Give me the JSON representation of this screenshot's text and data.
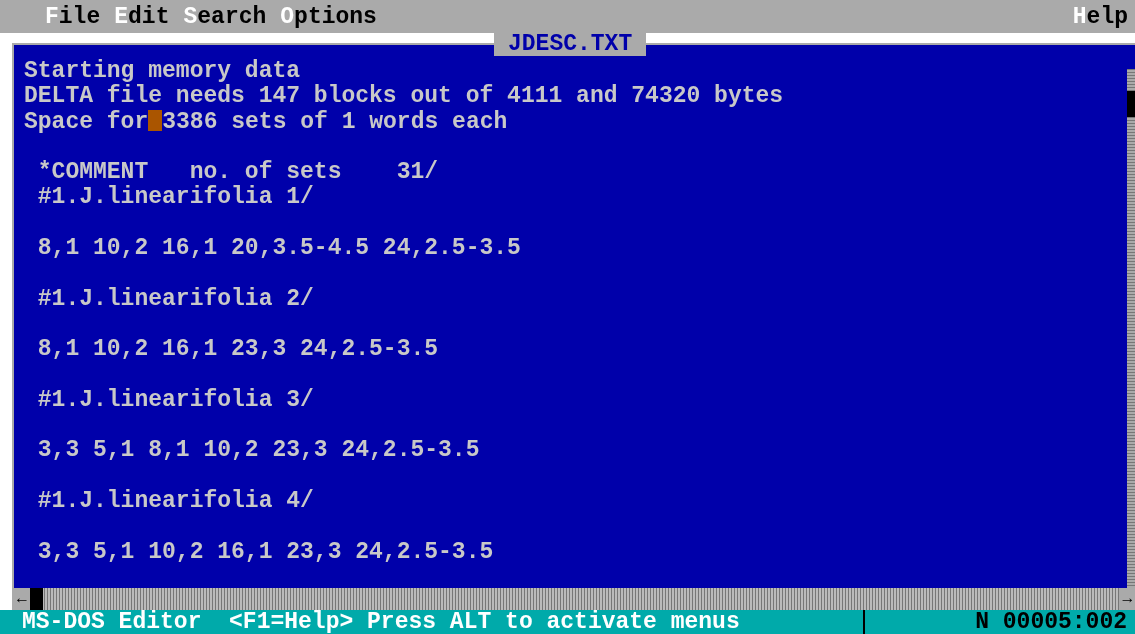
{
  "menu": [
    {
      "hotkey": "F",
      "rest": "ile"
    },
    {
      "hotkey": "E",
      "rest": "dit"
    },
    {
      "hotkey": "S",
      "rest": "earch"
    },
    {
      "hotkey": "O",
      "rest": "ptions"
    }
  ],
  "help_menu": {
    "hotkey": "H",
    "rest": "elp"
  },
  "document": {
    "title": "JDESC.TXT",
    "paragraphs": [
      [
        {
          "kind": "plain",
          "text": "Starting memory data"
        },
        {
          "kind": "plain",
          "text": "DELTA file needs 147 blocks out of 4111 and 74320 bytes"
        },
        {
          "kind": "cursor",
          "before": "Space for",
          "after": "3386 sets of 1 words each"
        }
      ],
      [
        {
          "kind": "plain",
          "text": " *COMMENT   no. of sets    31/"
        },
        {
          "kind": "plain",
          "text": " #1.J.linearifolia 1/"
        }
      ],
      [
        {
          "kind": "plain",
          "text": " 8,1 10,2 16,1 20,3.5-4.5 24,2.5-3.5"
        }
      ],
      [
        {
          "kind": "plain",
          "text": " #1.J.linearifolia 2/"
        }
      ],
      [
        {
          "kind": "plain",
          "text": " 8,1 10,2 16,1 23,3 24,2.5-3.5"
        }
      ],
      [
        {
          "kind": "plain",
          "text": " #1.J.linearifolia 3/"
        }
      ],
      [
        {
          "kind": "plain",
          "text": " 3,3 5,1 8,1 10,2 23,3 24,2.5-3.5"
        }
      ],
      [
        {
          "kind": "plain",
          "text": " #1.J.linearifolia 4/"
        }
      ],
      [
        {
          "kind": "plain",
          "text": " 3,3 5,1 10,2 16,1 23,3 24,2.5-3.5"
        }
      ]
    ]
  },
  "scrollbar": {
    "left_arrow": "←",
    "right_arrow": "→"
  },
  "status_bar": {
    "message": "MS-DOS Editor  <F1=Help> Press ALT to activate menus",
    "position": "N 00005:002"
  }
}
